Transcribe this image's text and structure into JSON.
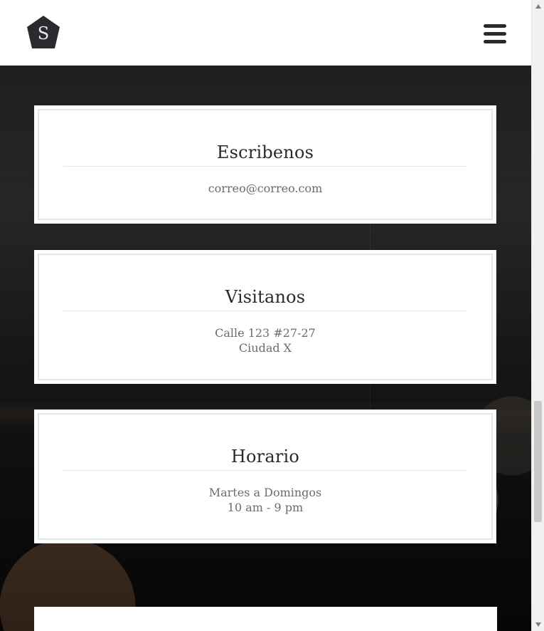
{
  "header": {
    "logo_letter": "S",
    "logo_icon": "pentagon-logo-icon",
    "menu_icon": "hamburger-menu-icon"
  },
  "sections": [
    {
      "title": "Escribenos",
      "lines": [
        "correo@correo.com"
      ]
    },
    {
      "title": "Visitanos",
      "lines": [
        "Calle 123 #27-27",
        "Ciudad X"
      ]
    },
    {
      "title": "Horario",
      "lines": [
        "Martes a Domingos",
        "10 am - 9 pm"
      ]
    }
  ],
  "colors": {
    "header_bg": "#ffffff",
    "card_bg": "#ffffff",
    "title": "#2a2a2a",
    "body_text": "#6b6b6b",
    "rule": "#e6e6e6",
    "logo_fill": "#2b2b2f"
  }
}
